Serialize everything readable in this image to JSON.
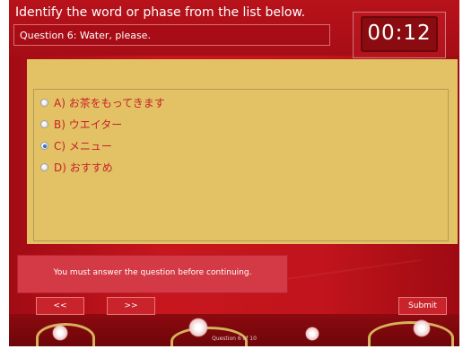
{
  "header": {
    "instruction": "Identify the word or phase from the list below.",
    "question": "Question 6:  Water, please."
  },
  "timer": {
    "value": "00:12"
  },
  "options": [
    {
      "label": "A) お茶をもってきます",
      "selected": false
    },
    {
      "label": "B) ウエイター",
      "selected": false
    },
    {
      "label": "C) メニュー",
      "selected": true
    },
    {
      "label": "D) おすすめ",
      "selected": false
    }
  ],
  "alert": {
    "message": "You must answer the question before continuing."
  },
  "nav": {
    "prev_label": "<<",
    "next_label": ">>",
    "submit_label": "Submit"
  },
  "footer": {
    "counter": "Question 6 of 10"
  },
  "colors": {
    "background_red": "#c1141c",
    "panel_gold": "#e2c265",
    "option_text": "#c8202a",
    "alert_red": "#d43a45"
  }
}
